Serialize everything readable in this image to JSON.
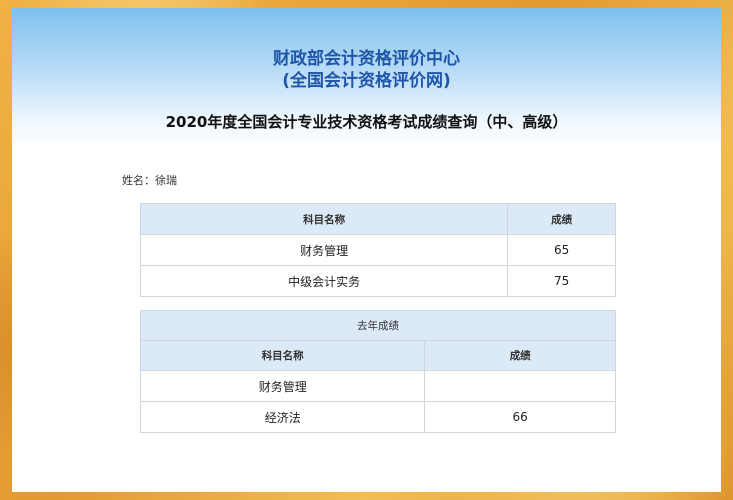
{
  "header": {
    "org_name": "财政部会计资格评价中心",
    "org_sub": "(全国会计资格评价网)",
    "query_title": "2020年度全国会计专业技术资格考试成绩查询（中、高级）"
  },
  "candidate": {
    "name_label": "姓名：徐瑞"
  },
  "current_scores": {
    "headers": [
      "科目名称",
      "成绩"
    ],
    "rows": [
      {
        "subject": "财务管理",
        "score": "65"
      },
      {
        "subject": "中级会计实务",
        "score": "75"
      }
    ]
  },
  "last_year": {
    "section_title": "去年成绩",
    "headers": [
      "科目名称",
      "成绩"
    ],
    "rows": [
      {
        "subject": "财务管理",
        "score": ""
      },
      {
        "subject": "经济法",
        "score": "66"
      }
    ]
  },
  "colors": {
    "title_blue": "#1f56a8",
    "header_cell": "#dbeaf6",
    "frame_gold": "#e9a83c"
  }
}
